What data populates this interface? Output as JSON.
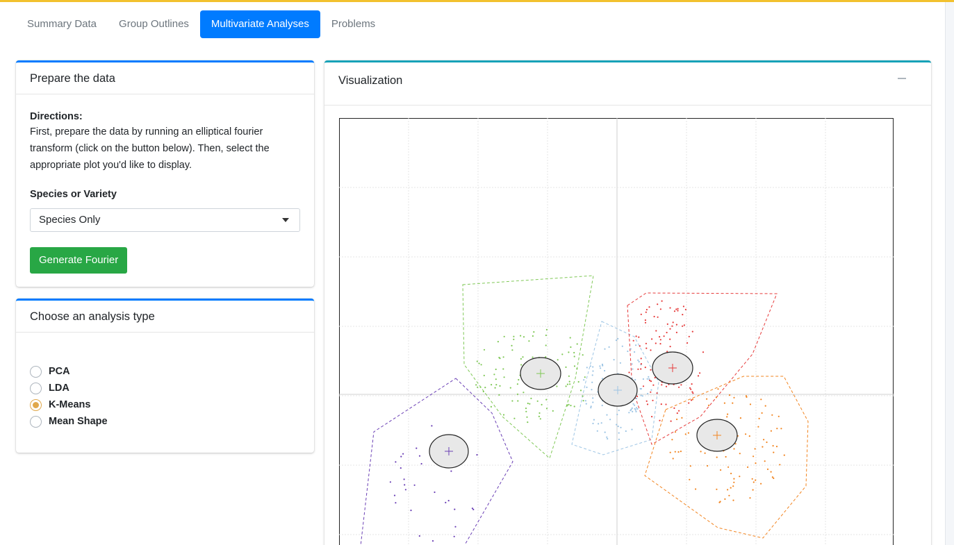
{
  "tabs": [
    {
      "label": "Summary Data",
      "active": false
    },
    {
      "label": "Group Outlines",
      "active": false
    },
    {
      "label": "Multivariate Analyses",
      "active": true
    },
    {
      "label": "Problems",
      "active": false
    }
  ],
  "prepare": {
    "title": "Prepare the data",
    "directions_title": "Directions:",
    "directions_lines": [
      "First, prepare the data by running an elliptical fourier",
      "transform (click on the button below). Then, select the",
      "appropriate plot you'd like to display."
    ],
    "species_label": "Species or Variety",
    "species_value": "Species Only",
    "button": "Generate Fourier"
  },
  "analysis": {
    "title": "Choose an analysis type",
    "options": [
      {
        "label": "PCA",
        "checked": false
      },
      {
        "label": "LDA",
        "checked": false
      },
      {
        "label": "K-Means",
        "checked": true
      },
      {
        "label": "Mean Shape",
        "checked": false
      }
    ]
  },
  "visualization": {
    "title": "Visualization"
  },
  "colors": {
    "accent": "#007bff",
    "top_bar": "#f2c12e",
    "button": "#28a745",
    "radio_checked": "#e0a84c",
    "clusters": [
      "#6a3fb5",
      "#7fc856",
      "#9cc4e4",
      "#e63a3a",
      "#f2841f"
    ]
  }
}
